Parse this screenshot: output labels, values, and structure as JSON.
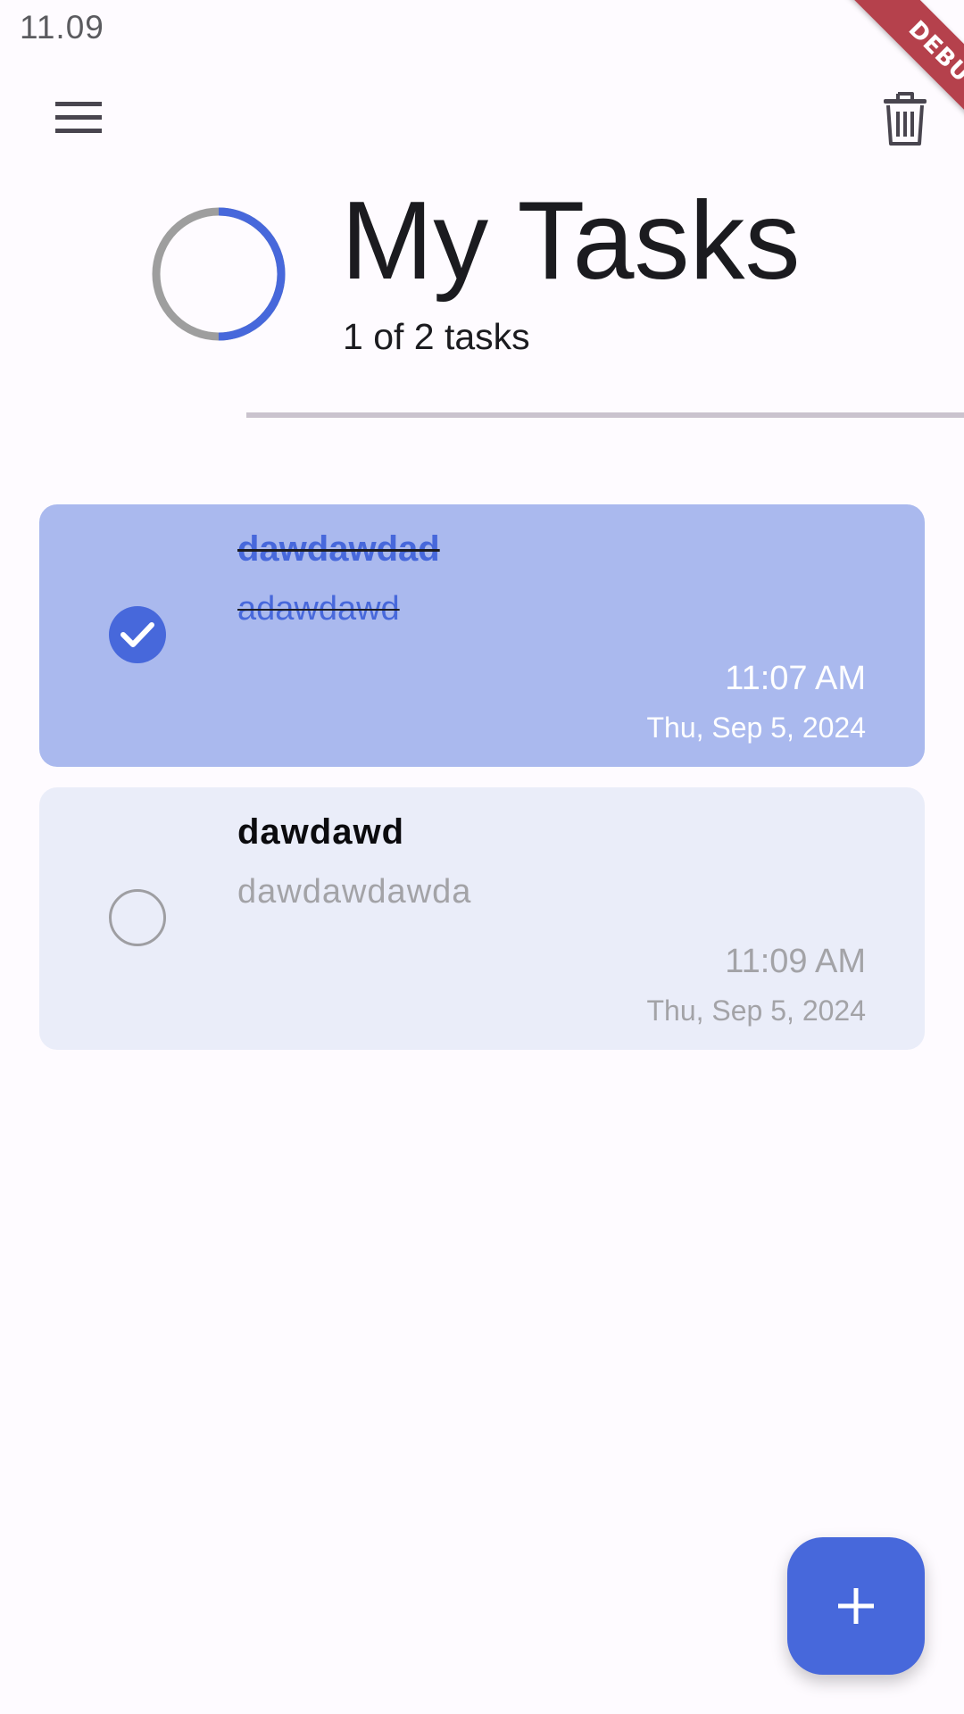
{
  "status_bar": {
    "time": "11.09"
  },
  "debug_banner": "DEBUG",
  "header": {
    "title": "My Tasks",
    "task_count": "1 of 2 tasks",
    "progress": 0.5
  },
  "icons": {
    "menu": "menu-icon",
    "delete": "trash-icon",
    "add": "plus-icon",
    "check": "check-icon"
  },
  "colors": {
    "accent": "#4768db",
    "completed_card": "#aab9ee",
    "open_card": "#eaedf9",
    "ring_track": "#9e9e9e",
    "debug_banner": "#b5414c"
  },
  "tasks": [
    {
      "title": "dawdawdad",
      "description": "adawdawd",
      "time": "11:07 AM",
      "date": "Thu, Sep 5, 2024",
      "completed": true
    },
    {
      "title": "dawdawd",
      "description": "dawdawdawda",
      "time": "11:09 AM",
      "date": "Thu, Sep 5, 2024",
      "completed": false
    }
  ]
}
